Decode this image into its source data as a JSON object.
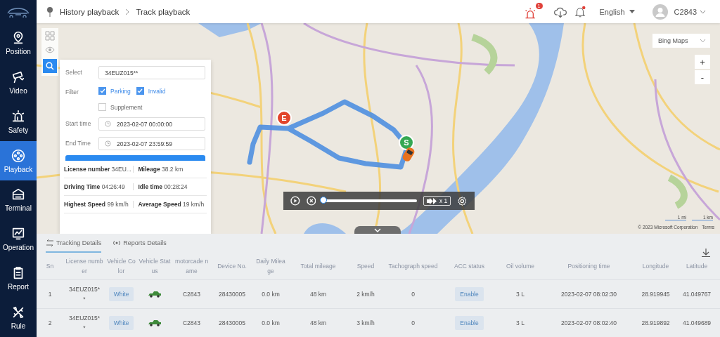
{
  "sidebar": {
    "items": [
      {
        "label": "Position",
        "selected": false
      },
      {
        "label": "Video",
        "selected": false
      },
      {
        "label": "Safety",
        "selected": false
      },
      {
        "label": "Playback",
        "selected": true
      },
      {
        "label": "Terminal",
        "selected": false
      },
      {
        "label": "Operation",
        "selected": false
      },
      {
        "label": "Report",
        "selected": false
      },
      {
        "label": "Rule",
        "selected": false
      }
    ]
  },
  "header": {
    "breadcrumb": [
      "History playback",
      "Track playback"
    ],
    "alarm_count": "1",
    "language": "English",
    "user": "C2843"
  },
  "map": {
    "layer_select": "Bing Maps",
    "zoom_in": "+",
    "zoom_out": "-",
    "scale": [
      "1 mi",
      "1 km"
    ],
    "copyright": "© 2023 Microsoft Corporation",
    "terms": "Terms",
    "end_marker": "E",
    "start_marker": "S"
  },
  "query_panel": {
    "select": {
      "label": "Select",
      "value": "34EUZ015**"
    },
    "filter": {
      "label": "Filter",
      "options": [
        {
          "label": "Parking",
          "checked": true
        },
        {
          "label": "Invalid",
          "checked": true
        },
        {
          "label": "Supplement",
          "checked": false
        }
      ]
    },
    "start_time": {
      "label": "Start time",
      "value": "2023-02-07 00:00:00"
    },
    "end_time": {
      "label": "End Time",
      "value": "2023-02-07 23:59:59"
    }
  },
  "summary": [
    {
      "label": "License number",
      "value": "34EU..."
    },
    {
      "label": "Mileage",
      "value": "38.2 km"
    },
    {
      "label": "Driving Time",
      "value": "04:26:49"
    },
    {
      "label": "Idle time",
      "value": "00:28:24"
    },
    {
      "label": "Highest Speed",
      "value": "99 km/h"
    },
    {
      "label": "Average Speed",
      "value": "19 km/h"
    }
  ],
  "playback": {
    "level": 0,
    "speed": "x 1"
  },
  "tabs": [
    {
      "label": "Tracking Details",
      "selected": true
    },
    {
      "label": "Reports Details",
      "selected": false
    }
  ],
  "table": {
    "columns": [
      "Sn",
      "License number",
      "Vehicle Color",
      "Vehicle Status",
      "motorcade name",
      "Device No.",
      "Daily Mileage",
      "Total mileage",
      "Speed",
      "Tachograph speed",
      "ACC status",
      "Oil volume",
      "Positioning time",
      "Longitude",
      "Latitude"
    ],
    "rows": [
      {
        "sn": "1",
        "license": "34EUZ015**",
        "vehicle_color": "White",
        "motorcade": "C2843",
        "device": "28430005",
        "daily_mileage": "0.0 km",
        "total_mileage": "48 km",
        "speed": "2 km/h",
        "tachograph_speed": "0",
        "acc": "Enable",
        "oil": "3 L",
        "time": "2023-02-07 08:02:30",
        "longitude": "28.919945",
        "latitude": "41.049767"
      },
      {
        "sn": "2",
        "license": "34EUZ015**",
        "vehicle_color": "White",
        "motorcade": "C2843",
        "device": "28430005",
        "daily_mileage": "0.0 km",
        "total_mileage": "48 km",
        "speed": "3 km/h",
        "tachograph_speed": "0",
        "acc": "Enable",
        "oil": "3 L",
        "time": "2023-02-07 08:02:40",
        "longitude": "28.919892",
        "latitude": "41.049689"
      }
    ]
  }
}
